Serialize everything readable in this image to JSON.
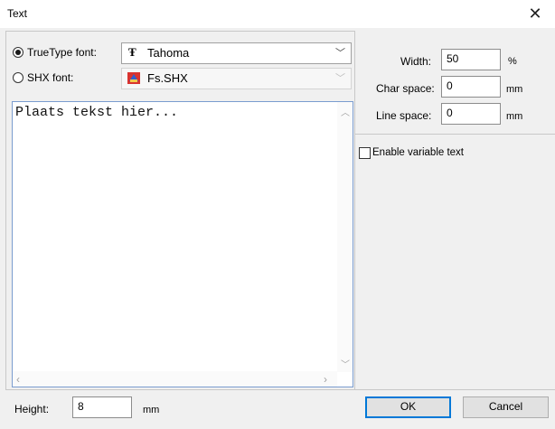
{
  "window": {
    "title": "Text",
    "close_glyph": "✕"
  },
  "font_options": {
    "truetype_label": "TrueType font:",
    "truetype_selected": true,
    "truetype_font": "Tahoma",
    "truetype_icon": "truetype-font-icon",
    "shx_label": "SHX font:",
    "shx_selected": false,
    "shx_font": "Fs.SHX",
    "shx_icon": "shx-font-icon",
    "dropdown_glyph": "﹀"
  },
  "text_area": {
    "content": "Plaats tekst hier..."
  },
  "spacing": {
    "width_label": "Width:",
    "width_value": "50",
    "width_unit": "%",
    "char_space_label": "Char space:",
    "char_space_value": "0",
    "char_space_unit": "mm",
    "line_space_label": "Line space:",
    "line_space_value": "0",
    "line_space_unit": "mm"
  },
  "variable_text": {
    "label": "Enable variable text",
    "checked": false
  },
  "height": {
    "label": "Height:",
    "value": "8",
    "unit": "mm"
  },
  "buttons": {
    "ok": "OK",
    "cancel": "Cancel"
  }
}
